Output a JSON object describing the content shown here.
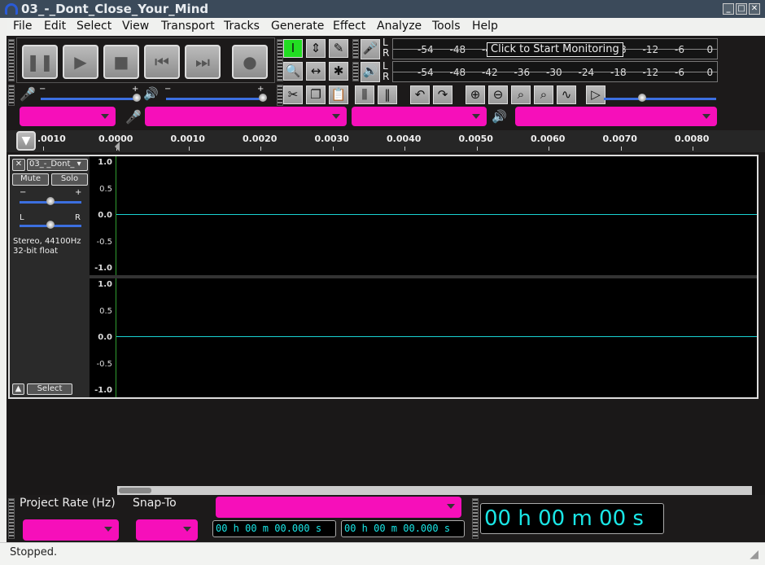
{
  "window": {
    "title": "03_-_Dont_Close_Your_Mind"
  },
  "menu": [
    "File",
    "Edit",
    "Select",
    "View",
    "Transport",
    "Tracks",
    "Generate",
    "Effect",
    "Analyze",
    "Tools",
    "Help"
  ],
  "transport": {
    "buttons": [
      {
        "name": "pause",
        "glyph": "❚❚"
      },
      {
        "name": "play",
        "glyph": "▶"
      },
      {
        "name": "stop",
        "glyph": "■"
      },
      {
        "name": "skip-start",
        "glyph": "⏮"
      },
      {
        "name": "skip-end",
        "glyph": "⏭"
      },
      {
        "name": "record",
        "glyph": "●"
      }
    ]
  },
  "tools": [
    {
      "name": "selection",
      "glyph": "I",
      "active": true
    },
    {
      "name": "envelope",
      "glyph": "⇕"
    },
    {
      "name": "draw",
      "glyph": "✎"
    },
    {
      "name": "zoom",
      "glyph": "🔍"
    },
    {
      "name": "timeshift",
      "glyph": "↔"
    },
    {
      "name": "multi",
      "glyph": "✱"
    }
  ],
  "meters": {
    "ticks": [
      "-54",
      "-48",
      "-42",
      "-36",
      "-30",
      "-24",
      "-18",
      "-12",
      "-6",
      "0"
    ],
    "lr": [
      "L",
      "R"
    ],
    "monitor_tooltip": "Click to Start Monitoring"
  },
  "mixer": {
    "minus": "−",
    "plus": "+"
  },
  "edit_tools": [
    {
      "name": "cut",
      "glyph": "✂"
    },
    {
      "name": "copy",
      "glyph": "❐"
    },
    {
      "name": "paste",
      "glyph": "📋"
    },
    {
      "name": "trim",
      "glyph": "⫼"
    },
    {
      "name": "silence",
      "glyph": "‖"
    },
    {
      "name": "undo",
      "glyph": "↶"
    },
    {
      "name": "redo",
      "glyph": "↷"
    },
    {
      "name": "zoom-in",
      "glyph": "⊕"
    },
    {
      "name": "zoom-out",
      "glyph": "⊖"
    },
    {
      "name": "fit-selection",
      "glyph": "⌕"
    },
    {
      "name": "fit-project",
      "glyph": "⌕"
    },
    {
      "name": "draw-wave",
      "glyph": "∿"
    },
    {
      "name": "play-at-speed",
      "glyph": "▷"
    }
  ],
  "ruler": {
    "ticks": [
      ".0010",
      "0.0000",
      "0.0010",
      "0.0020",
      "0.0030",
      "0.0040",
      "0.0050",
      "0.0060",
      "0.0070",
      "0.0080"
    ]
  },
  "track": {
    "name": "03_-_Dont_",
    "mute": "Mute",
    "solo": "Solo",
    "gain_minus": "−",
    "gain_plus": "+",
    "pan_left": "L",
    "pan_right": "R",
    "info1": "Stereo, 44100Hz",
    "info2": "32-bit float",
    "select": "Select",
    "close": "✕",
    "vruler": [
      "1.0",
      "0.5",
      "0.0",
      "-0.5",
      "-1.0"
    ]
  },
  "bottom": {
    "project_rate_label": "Project Rate (Hz)",
    "snap_to_label": "Snap-To",
    "sel_start": "00 h 00 m 00.000 s",
    "sel_end": "00 h 00 m 00.000 s",
    "audio_position": "00 h 00 m 00 s"
  },
  "status": "Stopped.",
  "colors": {
    "device_dropdown": "#f60fba",
    "waveform_center": "#1ad2d2",
    "active_tool": "#22dd22"
  }
}
